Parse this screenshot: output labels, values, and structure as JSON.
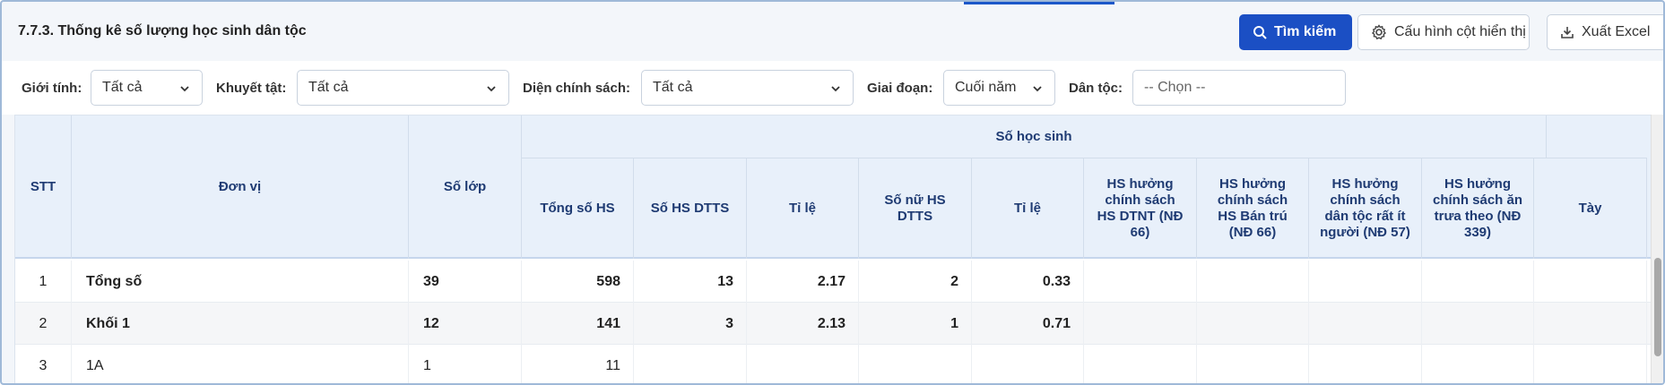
{
  "header": {
    "title": "7.7.3. Thống kê số lượng học sinh dân tộc",
    "search_label": "Tìm kiếm",
    "config_label": "Cấu hình cột hiển thị",
    "export_label": "Xuất Excel"
  },
  "filters": {
    "gender_label": "Giới tính:",
    "gender_value": "Tất cả",
    "disability_label": "Khuyết tật:",
    "disability_value": "Tất cả",
    "policy_label": "Diện chính sách:",
    "policy_value": "Tất cả",
    "stage_label": "Giai đoạn:",
    "stage_value": "Cuối năm",
    "ethnic_label": "Dân tộc:",
    "ethnic_placeholder": "-- Chọn --"
  },
  "table": {
    "headers": {
      "stt": "STT",
      "unit": "Đơn vị",
      "classes": "Số lớp",
      "group": "Số học sinh",
      "total": "Tổng số HS",
      "dtts": "Số HS DTTS",
      "ratio1": "Tỉ lệ",
      "female_dtts": "Số nữ HS DTTS",
      "ratio2": "Tỉ lệ",
      "dtnt": "HS hưởng chính sách HS DTNT (NĐ 66)",
      "bantru": "HS hưởng chính sách HS Bán trú (NĐ 66)",
      "ratitnguoi": "HS hưởng chính sách dân tộc rất ít người (NĐ 57)",
      "antrua": "HS hưởng chính sách ăn trưa theo (NĐ 339)",
      "tay": "Tày"
    },
    "rows": [
      {
        "stt": "1",
        "unit": "Tổng số",
        "classes": "39",
        "total": "598",
        "dtts": "13",
        "ratio1": "2.17",
        "female": "2",
        "ratio2": "0.33"
      },
      {
        "stt": "2",
        "unit": "Khối 1",
        "classes": "12",
        "total": "141",
        "dtts": "3",
        "ratio1": "2.13",
        "female": "1",
        "ratio2": "0.71"
      },
      {
        "stt": "3",
        "unit": "1A",
        "classes": "1",
        "total": "11",
        "dtts": "",
        "ratio1": "",
        "female": "",
        "ratio2": ""
      }
    ]
  },
  "colors": {
    "primary": "#1b4fc4",
    "header_bg": "#e8f0fa",
    "header_text": "#1f3b73"
  }
}
